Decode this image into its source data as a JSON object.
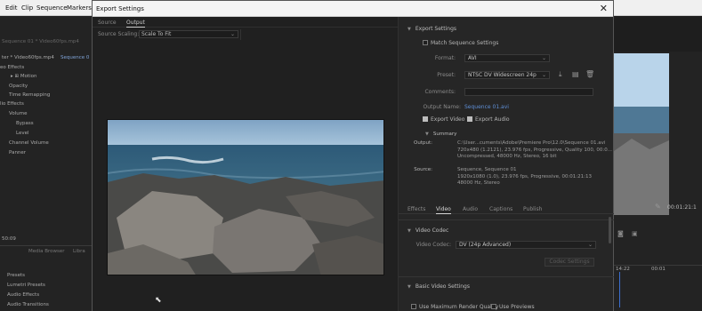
{
  "menubar": {
    "items": [
      "Edit",
      "Clip",
      "Sequence",
      "Markers"
    ]
  },
  "bg_left": {
    "rows": [
      "Sequence 01 * Video60fps.mp4",
      "ter * Video60fps.mp4",
      "Sequence 0",
      "eo Effects",
      "Motion",
      "Opacity",
      "Time Remapping",
      "lio Effects",
      "Volume",
      "Bypass",
      "Level",
      "Channel Volume",
      "Panner",
      "50:09",
      "Media Browser",
      "Libra",
      "Presets",
      "Lumetri Presets",
      "Audio Effects",
      "Audio Transitions"
    ]
  },
  "bg_right": {
    "timecode": "00:01:21:1",
    "time_a": "14:22",
    "time_b": "00:01"
  },
  "dialog": {
    "title": "Export Settings",
    "close": "✕"
  },
  "left": {
    "tabs": [
      "Source",
      "Output"
    ],
    "source_scaling_label": "Source Scaling:",
    "source_scaling_value": "Scale To Fit"
  },
  "right": {
    "export_settings_header": "Export Settings",
    "match_sequence": "Match Sequence Settings",
    "format_label": "Format:",
    "format_value": "AVI",
    "preset_label": "Preset:",
    "preset_value": "NTSC DV Widescreen 24p",
    "comments_label": "Comments:",
    "output_name_label": "Output Name:",
    "output_name_value": "Sequence 01.avi",
    "export_video": "Export Video",
    "export_audio": "Export Audio",
    "summary_header": "Summary",
    "summary_output_key": "Output:",
    "summary_output_lines": [
      "C:\\User...cuments\\Adobe\\Premiere Pro\\12.0\\Sequence 01.avi",
      "720x480 (1.2121), 23.976 fps, Progressive, Quality 100, 00:0...",
      "Uncompressed, 48000 Hz, Stereo, 16 bit"
    ],
    "summary_source_key": "Source:",
    "summary_source_lines": [
      "Sequence, Sequence 01",
      "1920x1080 (1.0), 23.976 fps, Progressive, 00:01:21:13",
      "48000 Hz, Stereo"
    ],
    "subtabs": [
      "Effects",
      "Video",
      "Audio",
      "Captions",
      "Publish"
    ],
    "video_codec_header": "Video Codec",
    "video_codec_label": "Video Codec:",
    "video_codec_value": "DV (24p Advanced)",
    "codec_settings_btn": "Codec Settings",
    "basic_video_header": "Basic Video Settings",
    "use_max_render": "Use Maximum Render Quality",
    "use_previews": "Use Previews"
  },
  "colors": {
    "link": "#5f8fd6",
    "bg": "#232323"
  }
}
